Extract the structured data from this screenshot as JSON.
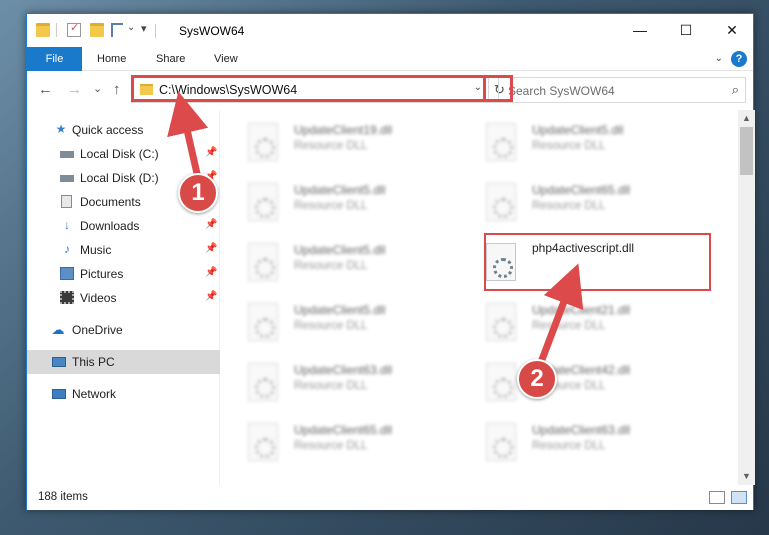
{
  "window": {
    "title": "SysWOW64",
    "controls": {
      "minimize": "—",
      "maximize": "☐",
      "close": "✕"
    }
  },
  "ribbon": {
    "tabs": [
      "File",
      "Home",
      "Share",
      "View"
    ],
    "help": "?"
  },
  "navigation": {
    "back": "←",
    "forward": "→",
    "recent": "⌄",
    "up": "↑",
    "address": "C:\\Windows\\SysWOW64",
    "refresh": "↻",
    "search_placeholder": "Search SysWOW64"
  },
  "sidebar": {
    "items": [
      {
        "label": "Quick access",
        "icon": "star-icon"
      },
      {
        "label": "Local Disk (C:)",
        "icon": "drive-icon",
        "pinned": true
      },
      {
        "label": "Local Disk (D:)",
        "icon": "drive-icon",
        "pinned": true
      },
      {
        "label": "Documents",
        "icon": "documents-icon",
        "pinned": true
      },
      {
        "label": "Downloads",
        "icon": "download-icon",
        "pinned": true
      },
      {
        "label": "Music",
        "icon": "music-icon",
        "pinned": true
      },
      {
        "label": "Pictures",
        "icon": "pictures-icon",
        "pinned": true
      },
      {
        "label": "Videos",
        "icon": "videos-icon",
        "pinned": true
      },
      {
        "label": "OneDrive",
        "icon": "cloud-icon"
      },
      {
        "label": "This PC",
        "icon": "computer-icon",
        "selected": true
      },
      {
        "label": "Network",
        "icon": "network-icon"
      }
    ]
  },
  "files": {
    "left": [
      {
        "name": "UpdateClient19.dll",
        "type": "Resource DLL"
      },
      {
        "name": "UpdateClient5.dll",
        "type": "Resource DLL"
      },
      {
        "name": "UpdateClient5.dll",
        "type": "Resource DLL"
      },
      {
        "name": "UpdateClient5.dll",
        "type": "Resource DLL"
      },
      {
        "name": "UpdateClient63.dll",
        "type": "Resource DLL"
      },
      {
        "name": "UpdateClient65.dll",
        "type": "Resource DLL"
      }
    ],
    "right": [
      {
        "name": "UpdateClient5.dll",
        "type": "Resource DLL"
      },
      {
        "name": "UpdateClient65.dll",
        "type": "Resource DLL"
      },
      {
        "name": "php4activescript.dll",
        "type": ""
      },
      {
        "name": "UpdateClient21.dll",
        "type": "Resource DLL"
      },
      {
        "name": "UpdateClient42.dll",
        "type": "Resource DLL"
      },
      {
        "name": "UpdateClient63.dll",
        "type": "Resource DLL"
      }
    ]
  },
  "status": {
    "item_count": "188 items"
  },
  "callouts": {
    "first": "1",
    "second": "2"
  },
  "colors": {
    "accent": "#1979ca",
    "highlight": "#dc4a4b"
  }
}
